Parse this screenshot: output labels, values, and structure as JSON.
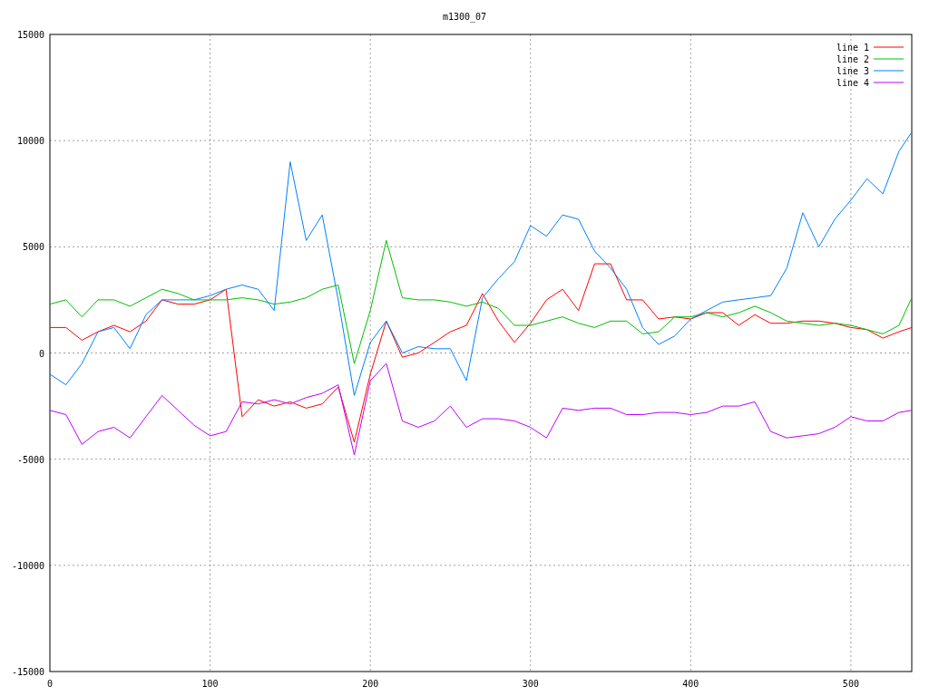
{
  "chart_data": {
    "type": "line",
    "title": "m1300_07",
    "x": [
      0,
      10,
      20,
      30,
      40,
      50,
      60,
      70,
      80,
      90,
      100,
      110,
      120,
      130,
      140,
      150,
      160,
      170,
      180,
      190,
      200,
      210,
      220,
      230,
      240,
      250,
      260,
      270,
      280,
      290,
      300,
      310,
      320,
      330,
      340,
      350,
      360,
      370,
      380,
      390,
      400,
      410,
      420,
      430,
      440,
      450,
      460,
      470,
      480,
      490,
      500,
      510,
      520,
      530,
      538
    ],
    "series": [
      {
        "name": "line 1",
        "color": "#ff0000",
        "values": [
          1200,
          1200,
          600,
          1000,
          1300,
          1000,
          1500,
          2500,
          2300,
          2300,
          2500,
          3000,
          -3000,
          -2200,
          -2500,
          -2300,
          -2600,
          -2400,
          -1600,
          -4200,
          -1000,
          1500,
          -200,
          0,
          500,
          1000,
          1300,
          2800,
          1500,
          500,
          1400,
          2500,
          3000,
          2000,
          4200,
          4200,
          2500,
          2500,
          1600,
          1700,
          1600,
          1900,
          1900,
          1300,
          1800,
          1400,
          1400,
          1500,
          1500,
          1400,
          1200,
          1100,
          700,
          1000,
          1200
        ]
      },
      {
        "name": "line 2",
        "color": "#00c000",
        "values": [
          2300,
          2500,
          1700,
          2500,
          2500,
          2200,
          2600,
          3000,
          2800,
          2500,
          2500,
          2500,
          2600,
          2500,
          2300,
          2400,
          2600,
          3000,
          3200,
          -500,
          2000,
          5300,
          2600,
          2500,
          2500,
          2400,
          2200,
          2400,
          2100,
          1300,
          1300,
          1500,
          1700,
          1400,
          1200,
          1500,
          1500,
          900,
          1000,
          1700,
          1700,
          1900,
          1700,
          1900,
          2200,
          1900,
          1500,
          1400,
          1300,
          1400,
          1300,
          1100,
          900,
          1300,
          2600
        ]
      },
      {
        "name": "line 3",
        "color": "#0080ff",
        "values": [
          -1000,
          -1500,
          -500,
          1000,
          1200,
          200,
          1800,
          2500,
          2500,
          2500,
          2700,
          3000,
          3200,
          3000,
          2000,
          9000,
          5300,
          6500,
          2500,
          -2000,
          500,
          1500,
          0,
          300,
          200,
          200,
          -1300,
          2600,
          3500,
          4300,
          6000,
          5500,
          6500,
          6300,
          4800,
          4000,
          3000,
          1200,
          400,
          800,
          1600,
          2000,
          2400,
          2500,
          2600,
          2700,
          4000,
          6600,
          5000,
          6300,
          7200,
          8200,
          7500,
          9500,
          10400
        ]
      },
      {
        "name": "line 4",
        "color": "#c000ff",
        "values": [
          -2700,
          -2900,
          -4300,
          -3700,
          -3500,
          -4000,
          -3000,
          -2000,
          -2700,
          -3400,
          -3900,
          -3700,
          -2300,
          -2400,
          -2200,
          -2400,
          -2100,
          -1900,
          -1500,
          -4800,
          -1300,
          -500,
          -3200,
          -3500,
          -3200,
          -2500,
          -3500,
          -3100,
          -3100,
          -3200,
          -3500,
          -4000,
          -2600,
          -2700,
          -2600,
          -2600,
          -2900,
          -2900,
          -2800,
          -2800,
          -2900,
          -2800,
          -2500,
          -2500,
          -2300,
          -3700,
          -4000,
          -3900,
          -3800,
          -3500,
          -3000,
          -3200,
          -3200,
          -2800,
          -2700
        ]
      }
    ],
    "xlim": [
      0,
      538
    ],
    "ylim": [
      -15000,
      15000
    ],
    "xticks": [
      0,
      100,
      200,
      300,
      400,
      500
    ],
    "yticks": [
      -15000,
      -10000,
      -5000,
      0,
      5000,
      10000,
      15000
    ],
    "grid": true,
    "legend": true
  }
}
